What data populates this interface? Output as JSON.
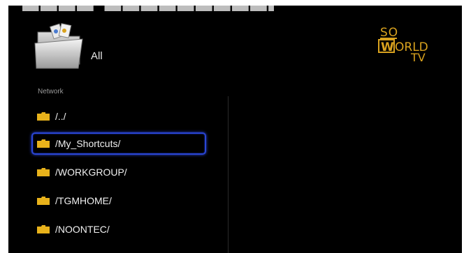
{
  "header": {
    "title": "All",
    "logo": {
      "line1": "SO",
      "line2_initial": "W",
      "line2_rest": "ORLD",
      "line3": "TV",
      "color": "#d9a21e"
    }
  },
  "section": {
    "label": "Network"
  },
  "list": {
    "items": [
      {
        "label": "/../",
        "selected": false
      },
      {
        "label": "/My_Shortcuts/",
        "selected": true
      },
      {
        "label": "/WORKGROUP/",
        "selected": false
      },
      {
        "label": "/TGMHOME/",
        "selected": false
      },
      {
        "label": "/NOONTEC/",
        "selected": false
      }
    ],
    "folder_color": "#e8b21b",
    "selection_color": "#2a46d6"
  }
}
